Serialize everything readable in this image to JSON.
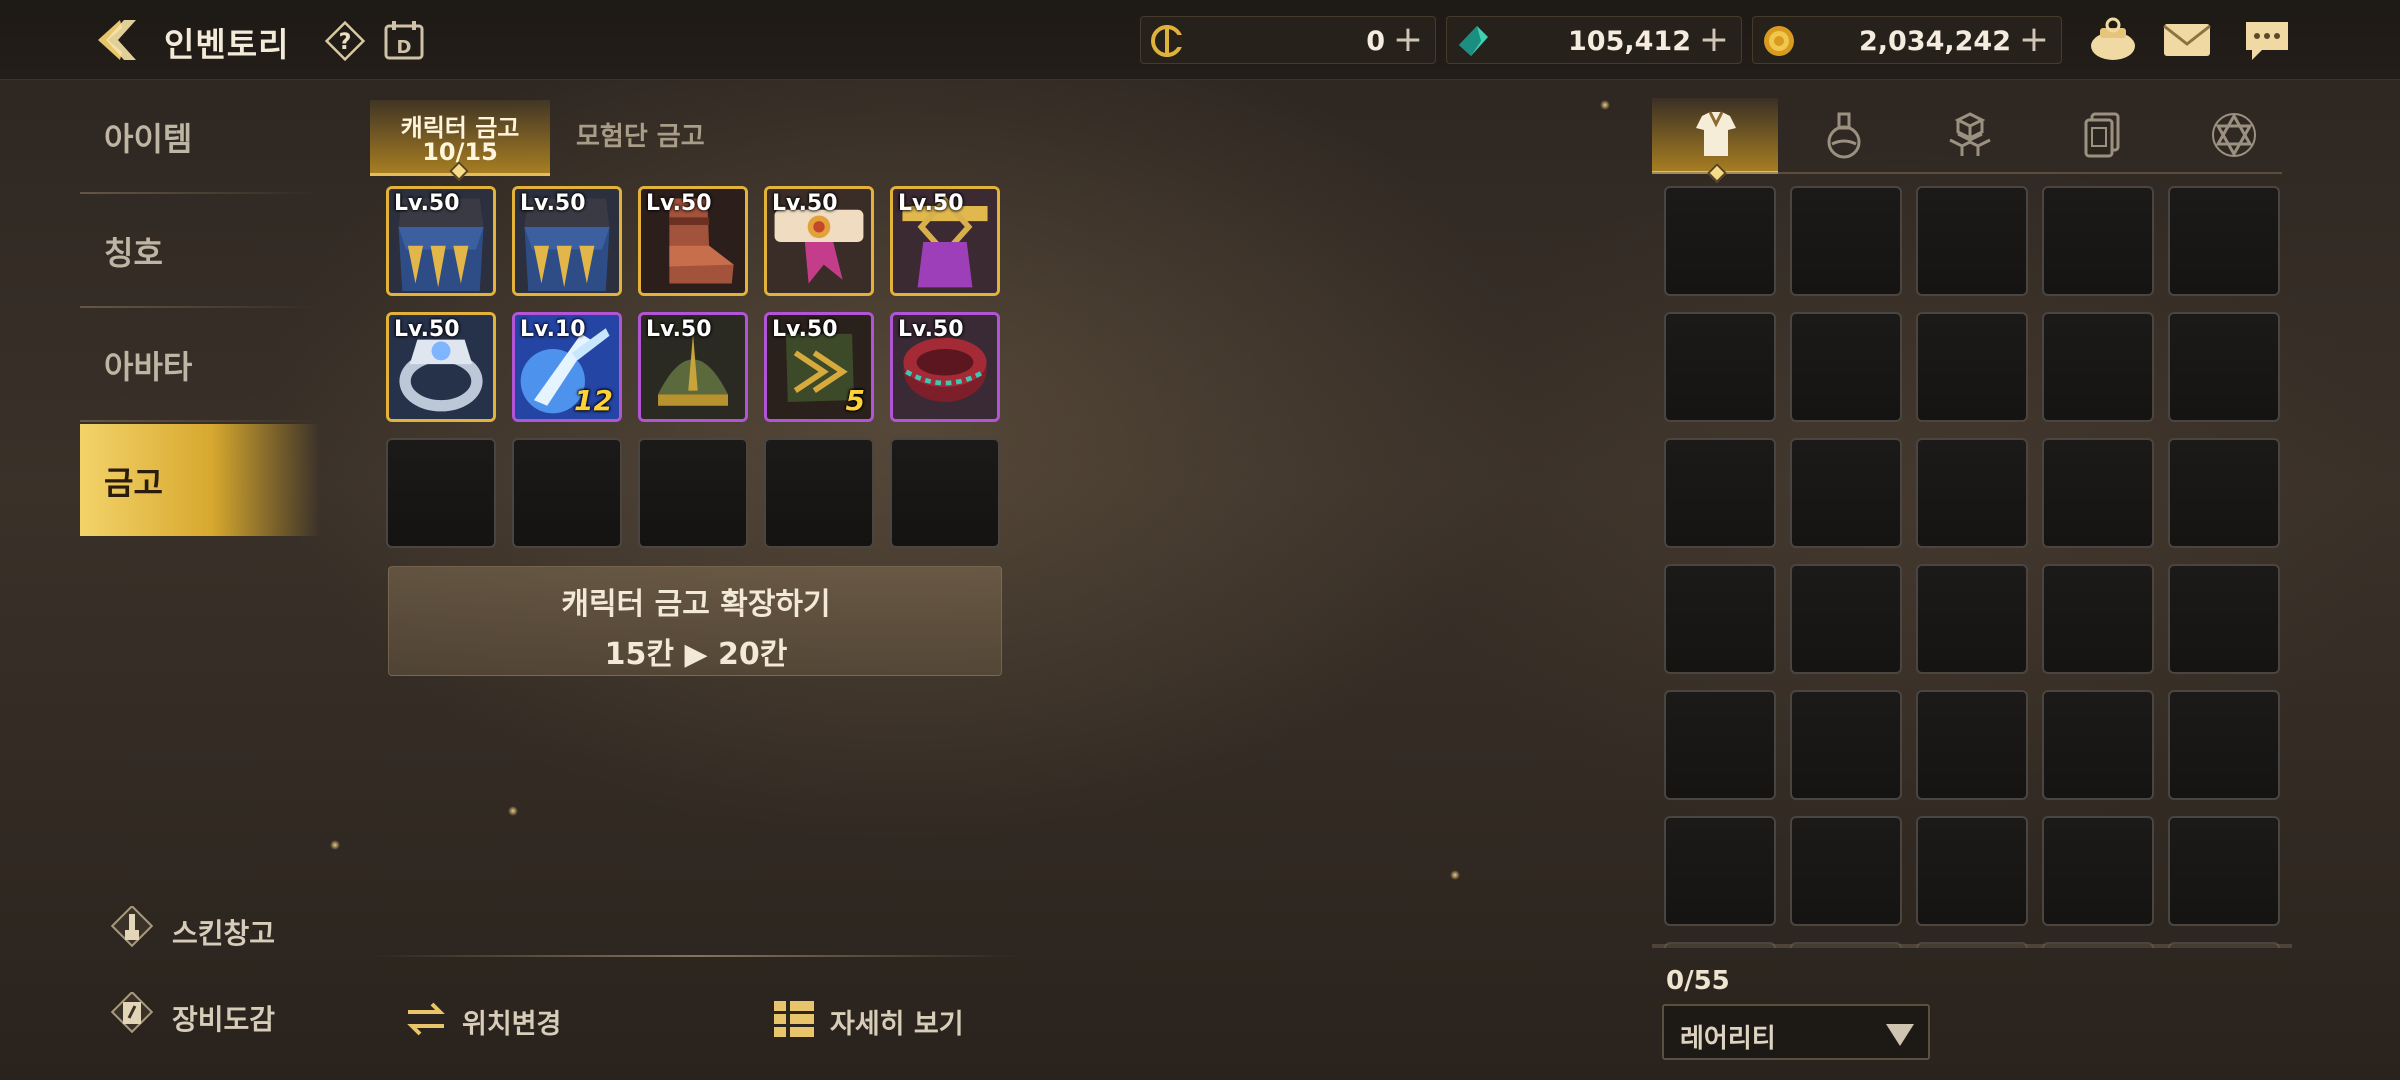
{
  "header": {
    "title": "인벤토리",
    "currencies": [
      {
        "icon": "c-coin-icon",
        "value": "0"
      },
      {
        "icon": "green-gem-icon",
        "value": "105,412"
      },
      {
        "icon": "gold-coin-icon",
        "value": "2,034,242"
      }
    ],
    "plus": "+"
  },
  "sidebar": {
    "items": [
      {
        "label": "아이템"
      },
      {
        "label": "칭호"
      },
      {
        "label": "아바타"
      },
      {
        "label": "금고"
      }
    ],
    "links": [
      {
        "label": "스킨창고",
        "icon": "brush-icon"
      },
      {
        "label": "장비도감",
        "icon": "book-icon"
      }
    ]
  },
  "storage": {
    "tabs": [
      {
        "label": "캐릭터 금고",
        "sub": "10/15"
      },
      {
        "label": "모험단 금고"
      }
    ],
    "slots": [
      {
        "lv": "Lv.50",
        "grade": "gold",
        "art": "claw-blue",
        "qty": ""
      },
      {
        "lv": "Lv.50",
        "grade": "gold",
        "art": "claw-blue",
        "qty": ""
      },
      {
        "lv": "Lv.50",
        "grade": "gold",
        "art": "boot",
        "qty": ""
      },
      {
        "lv": "Lv.50",
        "grade": "gold",
        "art": "belt",
        "qty": ""
      },
      {
        "lv": "Lv.50",
        "grade": "gold",
        "art": "sash",
        "qty": ""
      },
      {
        "lv": "Lv.50",
        "grade": "gold",
        "art": "ring",
        "qty": ""
      },
      {
        "lv": "Lv.10",
        "grade": "purple",
        "art": "blue-claw",
        "qty": "12"
      },
      {
        "lv": "Lv.50",
        "grade": "purple",
        "art": "helm",
        "qty": ""
      },
      {
        "lv": "Lv.50",
        "grade": "purple",
        "art": "scroll",
        "qty": "5"
      },
      {
        "lv": "Lv.50",
        "grade": "purple",
        "art": "drum",
        "qty": ""
      }
    ],
    "expand": {
      "line1": "캐릭터 금고 확장하기",
      "line2": "15칸 ▶ 20칸"
    }
  },
  "actions": [
    {
      "label": "위치변경",
      "icon": "swap-arrows-icon"
    },
    {
      "label": "자세히 보기",
      "icon": "list-view-icon"
    }
  ],
  "inventory": {
    "tabs": [
      {
        "icon": "armor-icon"
      },
      {
        "icon": "potion-icon"
      },
      {
        "icon": "materials-icon"
      },
      {
        "icon": "cards-icon"
      },
      {
        "icon": "hexagram-icon"
      }
    ],
    "count": "0/55",
    "sort": "레어리티"
  },
  "colors": {
    "accent_gold": "#e3b23a",
    "grade_purple": "#b154d6",
    "active_tab": "#d7a82e"
  }
}
